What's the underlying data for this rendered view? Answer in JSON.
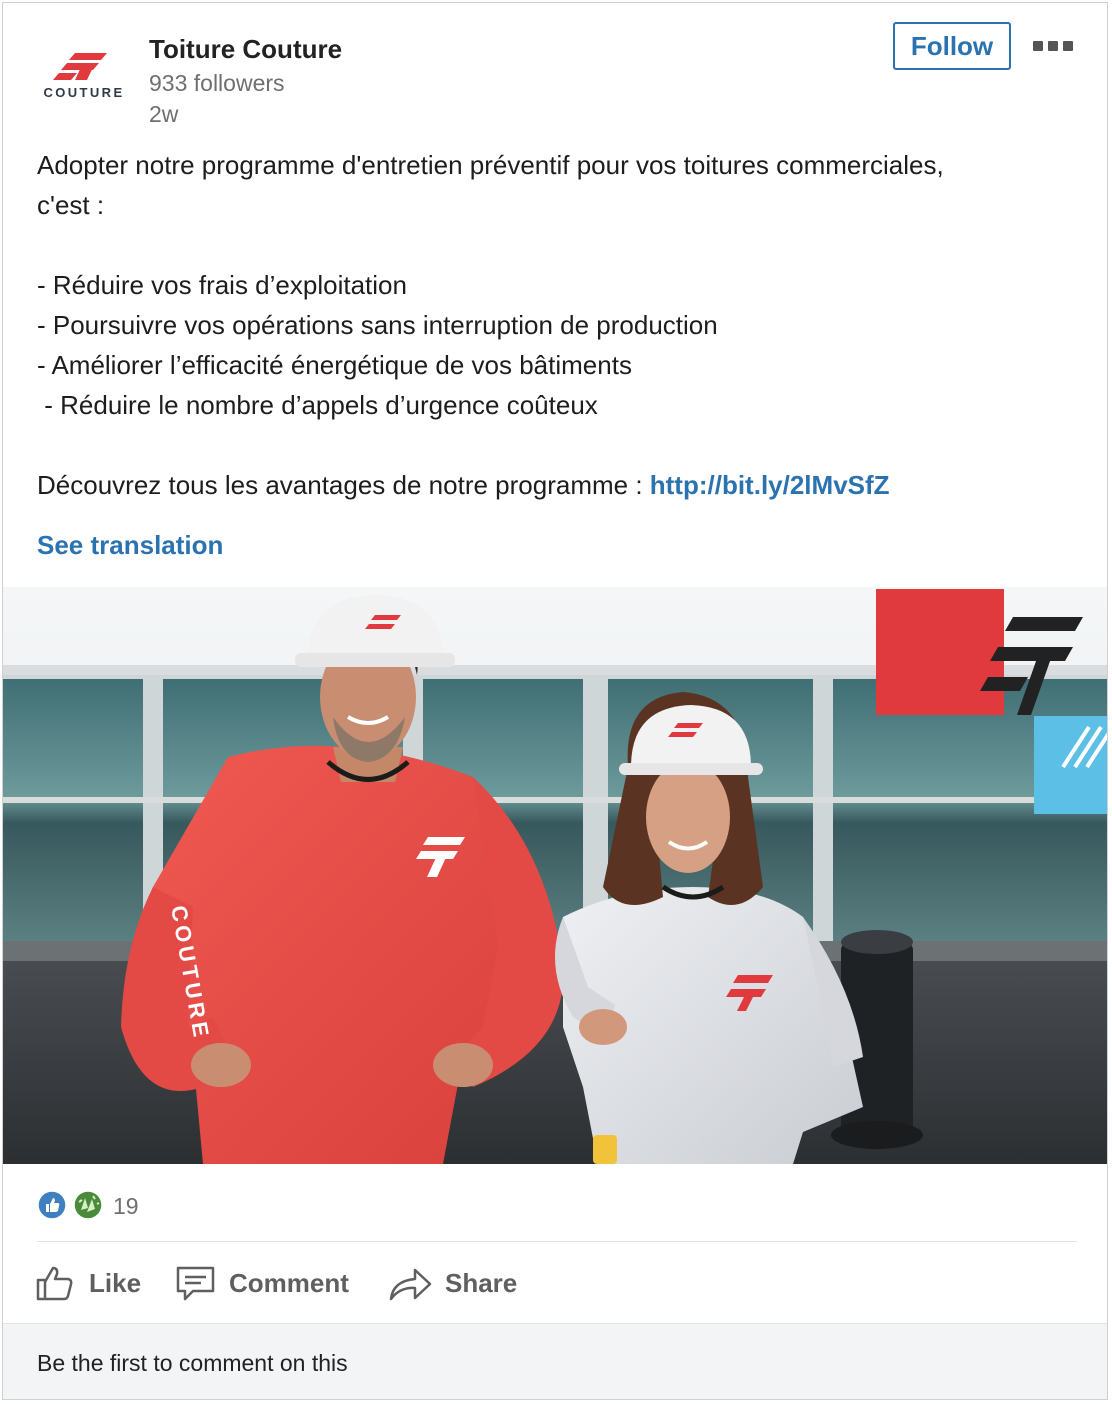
{
  "header": {
    "logo_text": "COUTURE",
    "org_name": "Toiture Couture",
    "followers": "933 followers",
    "time_ago": "2w",
    "follow_label": "Follow"
  },
  "post": {
    "lines": [
      "Adopter notre programme d'entretien préventif pour vos toitures commerciales,",
      "c'est :",
      "",
      "- Réduire vos frais d’exploitation",
      "- Poursuivre vos opérations sans interruption de production",
      "- Améliorer l’efficacité énergétique de vos bâtiments",
      " - Réduire le nombre d’appels d’urgence coûteux",
      "",
      "Découvrez tous les avantages de notre programme : "
    ],
    "link": "http://bit.ly/2lMvSfZ",
    "see_translation": "See translation"
  },
  "photo": {
    "sleeve_text": "COUTURE",
    "icon": "two-workers-in-hard-hats-photo"
  },
  "reactions": {
    "icons": [
      "like-reaction-icon",
      "celebrate-reaction-icon"
    ],
    "count": "19"
  },
  "actions": {
    "like": "Like",
    "comment": "Comment",
    "share": "Share"
  },
  "comments": {
    "prompt": "Be the first to comment on this"
  },
  "colors": {
    "brand_blue": "#2b72b0",
    "brand_red": "#e03a3e",
    "accent_cyan": "#5bbfe6"
  }
}
